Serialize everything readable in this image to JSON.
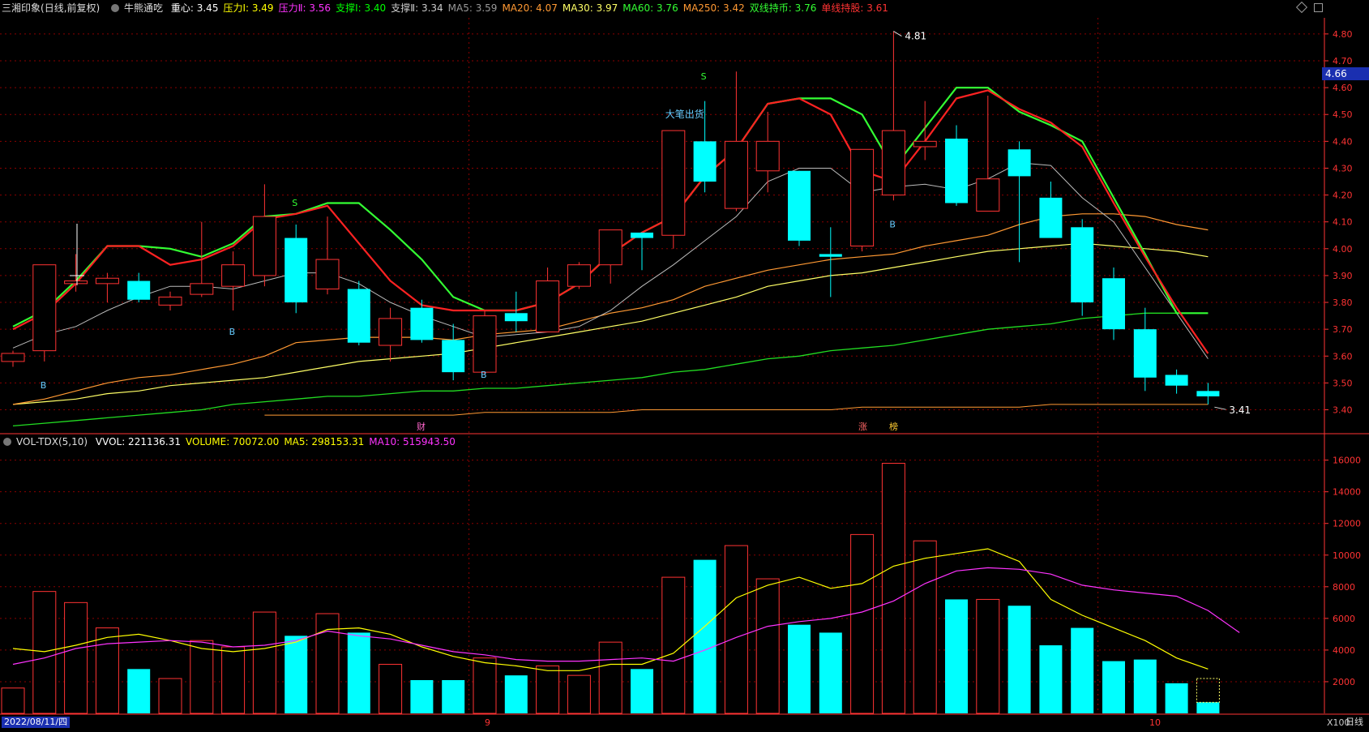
{
  "header": {
    "title": "三湘印象",
    "mode": "(日线,前复权)",
    "indicator": "牛熊通吃",
    "items": [
      {
        "label": "重心:",
        "value": "3.45",
        "color": "#ffffff"
      },
      {
        "label": "压力Ⅰ:",
        "value": "3.49",
        "color": "#ffff00"
      },
      {
        "label": "压力Ⅱ:",
        "value": "3.56",
        "color": "#ff33ff"
      },
      {
        "label": "支撑Ⅰ:",
        "value": "3.40",
        "color": "#00ff00"
      },
      {
        "label": "支撑Ⅱ:",
        "value": "3.34",
        "color": "#cccccc"
      },
      {
        "label": "MA5:",
        "value": "3.59",
        "color": "#999999"
      },
      {
        "label": "MA20:",
        "value": "4.07",
        "color": "#ff9933"
      },
      {
        "label": "MA30:",
        "value": "3.97",
        "color": "#ffff66"
      },
      {
        "label": "MA60:",
        "value": "3.76",
        "color": "#33ff33"
      },
      {
        "label": "MA250:",
        "value": "3.42",
        "color": "#ff9933"
      },
      {
        "label": "双线持币:",
        "value": "3.76",
        "color": "#33ff33"
      },
      {
        "label": "单线持股:",
        "value": "3.61",
        "color": "#ff3333"
      }
    ]
  },
  "vol_header": {
    "indicator": "VOL-TDX(5,10)",
    "items": [
      {
        "label": "VVOL:",
        "value": "221136.31",
        "color": "#ffffff"
      },
      {
        "label": "VOLUME:",
        "value": "70072.00",
        "color": "#ffff00"
      },
      {
        "label": "MA5:",
        "value": "298153.31",
        "color": "#ffff00"
      },
      {
        "label": "MA10:",
        "value": "515943.50",
        "color": "#ff33ff"
      }
    ]
  },
  "current_price": "4.66",
  "footer": {
    "date": "2022/08/11/四",
    "month_9": "9",
    "month_10": "10",
    "period": "日线",
    "scale": "X100"
  },
  "colors": {
    "up": "#ff3333",
    "down": "#00ffff",
    "grid": "#8b0000",
    "axis": "#ff3333"
  },
  "annotations": {
    "high_label": "4.81",
    "low_label": "3.41",
    "big_sell": "大笔出货",
    "events": [
      "财",
      "涨",
      "榜"
    ],
    "signals": [
      "S",
      "S",
      "B",
      "B",
      "B",
      "B"
    ]
  },
  "chart_data": {
    "type": "candlestick",
    "price_axis": {
      "ylim": [
        3.32,
        4.86
      ],
      "ticks": [
        "4.80",
        "4.70",
        "4.60",
        "4.50",
        "4.40",
        "4.30",
        "4.20",
        "4.10",
        "4.00",
        "3.90",
        "3.80",
        "3.70",
        "3.60",
        "3.50",
        "3.40"
      ]
    },
    "volume_axis": {
      "ylim": [
        0,
        16800
      ],
      "ticks": [
        "16000",
        "14000",
        "12000",
        "10000",
        "8000",
        "6000",
        "4000",
        "2000"
      ]
    },
    "candles": [
      {
        "o": 3.58,
        "h": 3.62,
        "l": 3.56,
        "c": 3.61
      },
      {
        "o": 3.62,
        "h": 3.94,
        "l": 3.58,
        "c": 3.94
      },
      {
        "o": 3.87,
        "h": 3.98,
        "l": 3.84,
        "c": 3.88
      },
      {
        "o": 3.87,
        "h": 3.91,
        "l": 3.8,
        "c": 3.89
      },
      {
        "o": 3.88,
        "h": 3.91,
        "l": 3.8,
        "c": 3.81
      },
      {
        "o": 3.79,
        "h": 3.84,
        "l": 3.77,
        "c": 3.82
      },
      {
        "o": 3.83,
        "h": 4.1,
        "l": 3.82,
        "c": 3.87
      },
      {
        "o": 3.86,
        "h": 3.99,
        "l": 3.77,
        "c": 3.94
      },
      {
        "o": 3.9,
        "h": 4.24,
        "l": 3.86,
        "c": 4.12
      },
      {
        "o": 4.04,
        "h": 4.09,
        "l": 3.76,
        "c": 3.8
      },
      {
        "o": 3.85,
        "h": 4.12,
        "l": 3.83,
        "c": 3.96
      },
      {
        "o": 3.85,
        "h": 3.88,
        "l": 3.64,
        "c": 3.65
      },
      {
        "o": 3.64,
        "h": 3.78,
        "l": 3.58,
        "c": 3.74
      },
      {
        "o": 3.78,
        "h": 3.81,
        "l": 3.65,
        "c": 3.66
      },
      {
        "o": 3.66,
        "h": 3.72,
        "l": 3.51,
        "c": 3.54
      },
      {
        "o": 3.54,
        "h": 3.77,
        "l": 3.53,
        "c": 3.75
      },
      {
        "o": 3.76,
        "h": 3.84,
        "l": 3.69,
        "c": 3.73
      },
      {
        "o": 3.69,
        "h": 3.93,
        "l": 3.69,
        "c": 3.88
      },
      {
        "o": 3.86,
        "h": 3.95,
        "l": 3.85,
        "c": 3.94
      },
      {
        "o": 3.94,
        "h": 4.07,
        "l": 3.87,
        "c": 4.07
      },
      {
        "o": 4.06,
        "h": 4.06,
        "l": 3.92,
        "c": 4.04
      },
      {
        "o": 4.05,
        "h": 4.44,
        "l": 4.0,
        "c": 4.44
      },
      {
        "o": 4.4,
        "h": 4.55,
        "l": 4.21,
        "c": 4.25
      },
      {
        "o": 4.15,
        "h": 4.66,
        "l": 4.14,
        "c": 4.4
      },
      {
        "o": 4.29,
        "h": 4.51,
        "l": 4.21,
        "c": 4.4
      },
      {
        "o": 4.29,
        "h": 4.29,
        "l": 4.01,
        "c": 4.03
      },
      {
        "o": 3.98,
        "h": 4.08,
        "l": 3.82,
        "c": 3.97
      },
      {
        "o": 4.01,
        "h": 4.37,
        "l": 3.99,
        "c": 4.37
      },
      {
        "o": 4.2,
        "h": 4.81,
        "l": 4.18,
        "c": 4.44
      },
      {
        "o": 4.38,
        "h": 4.55,
        "l": 4.33,
        "c": 4.4
      },
      {
        "o": 4.41,
        "h": 4.46,
        "l": 4.16,
        "c": 4.17
      },
      {
        "o": 4.14,
        "h": 4.57,
        "l": 4.14,
        "c": 4.26
      },
      {
        "o": 4.37,
        "h": 4.4,
        "l": 3.95,
        "c": 4.27
      },
      {
        "o": 4.19,
        "h": 4.25,
        "l": 4.04,
        "c": 4.04
      },
      {
        "o": 4.08,
        "h": 4.11,
        "l": 3.75,
        "c": 3.8
      },
      {
        "o": 3.89,
        "h": 3.93,
        "l": 3.66,
        "c": 3.7
      },
      {
        "o": 3.7,
        "h": 3.78,
        "l": 3.47,
        "c": 3.52
      },
      {
        "o": 3.53,
        "h": 3.55,
        "l": 3.46,
        "c": 3.49
      },
      {
        "o": 3.47,
        "h": 3.5,
        "l": 3.42,
        "c": 3.45
      }
    ],
    "volume": [
      1600,
      7700,
      7000,
      5400,
      2800,
      2200,
      4600,
      4200,
      6400,
      4900,
      6300,
      5100,
      3100,
      2100,
      2100,
      3500,
      2400,
      3000,
      2400,
      4500,
      2800,
      8600,
      9700,
      10600,
      8500,
      5600,
      5100,
      11300,
      15800,
      10900,
      7200,
      7200,
      6800,
      4300,
      5400,
      3300,
      3400,
      1900,
      700
    ],
    "lines": {
      "single_hold_red": [
        3.7,
        3.76,
        3.87,
        4.01,
        4.01,
        3.94,
        3.96,
        4.01,
        4.11,
        4.13,
        4.16,
        4.02,
        3.88,
        3.79,
        3.77,
        3.77,
        3.77,
        3.8,
        3.87,
        3.98,
        4.06,
        4.12,
        4.27,
        4.37,
        4.54,
        4.56,
        4.5,
        4.29,
        4.25,
        4.4,
        4.56,
        4.59,
        4.52,
        4.47,
        4.38,
        4.17,
        3.97,
        3.78,
        3.61
      ],
      "double_cash_green": [
        3.71,
        3.77,
        3.88,
        4.01,
        4.01,
        4.0,
        3.97,
        4.02,
        4.12,
        4.13,
        4.17,
        4.17,
        4.07,
        3.96,
        3.82,
        3.77,
        3.77,
        3.8,
        3.87,
        3.98,
        4.06,
        4.12,
        4.27,
        4.37,
        4.54,
        4.56,
        4.56,
        4.5,
        4.3,
        4.45,
        4.6,
        4.6,
        4.51,
        4.46,
        4.4,
        4.19,
        3.98,
        3.76,
        3.76
      ],
      "ma5": [
        3.63,
        3.68,
        3.71,
        3.77,
        3.82,
        3.86,
        3.86,
        3.85,
        3.88,
        3.91,
        3.91,
        3.87,
        3.8,
        3.75,
        3.71,
        3.67,
        3.68,
        3.69,
        3.71,
        3.77,
        3.86,
        3.94,
        4.03,
        4.12,
        4.25,
        4.3,
        4.3,
        4.21,
        4.23,
        4.24,
        4.22,
        4.26,
        4.32,
        4.31,
        4.19,
        4.1,
        3.93,
        3.76,
        3.59
      ],
      "ma20": [
        3.42,
        3.44,
        3.47,
        3.5,
        3.52,
        3.53,
        3.55,
        3.57,
        3.6,
        3.65,
        3.66,
        3.67,
        3.67,
        3.67,
        3.66,
        3.68,
        3.69,
        3.7,
        3.73,
        3.76,
        3.78,
        3.81,
        3.86,
        3.89,
        3.92,
        3.94,
        3.96,
        3.97,
        3.98,
        4.01,
        4.03,
        4.05,
        4.09,
        4.12,
        4.13,
        4.13,
        4.12,
        4.09,
        4.07
      ],
      "ma30": [
        3.42,
        3.43,
        3.44,
        3.46,
        3.47,
        3.49,
        3.5,
        3.51,
        3.52,
        3.54,
        3.56,
        3.58,
        3.59,
        3.6,
        3.61,
        3.63,
        3.65,
        3.67,
        3.69,
        3.71,
        3.73,
        3.76,
        3.79,
        3.82,
        3.86,
        3.88,
        3.9,
        3.91,
        3.93,
        3.95,
        3.97,
        3.99,
        4.0,
        4.01,
        4.02,
        4.01,
        4.0,
        3.99,
        3.97
      ],
      "ma60": [
        3.34,
        3.35,
        3.36,
        3.37,
        3.38,
        3.39,
        3.4,
        3.42,
        3.43,
        3.44,
        3.45,
        3.45,
        3.46,
        3.47,
        3.47,
        3.48,
        3.48,
        3.49,
        3.5,
        3.51,
        3.52,
        3.54,
        3.55,
        3.57,
        3.59,
        3.6,
        3.62,
        3.63,
        3.64,
        3.66,
        3.68,
        3.7,
        3.71,
        3.72,
        3.74,
        3.75,
        3.76,
        3.76,
        3.76
      ],
      "ma250": [
        null,
        null,
        null,
        null,
        null,
        null,
        null,
        null,
        3.38,
        3.38,
        3.38,
        3.38,
        3.38,
        3.38,
        3.38,
        3.39,
        3.39,
        3.39,
        3.39,
        3.39,
        3.4,
        3.4,
        3.4,
        3.4,
        3.4,
        3.4,
        3.4,
        3.41,
        3.41,
        3.41,
        3.41,
        3.41,
        3.41,
        3.42,
        3.42,
        3.42,
        3.42,
        3.42,
        3.42
      ],
      "vol_ma5": [
        4100,
        3900,
        4300,
        4800,
        5000,
        4600,
        4100,
        3900,
        4100,
        4500,
        5300,
        5400,
        5000,
        4200,
        3600,
        3200,
        3000,
        2700,
        2700,
        3100,
        3100,
        3800,
        5500,
        7300,
        8100,
        8600,
        7900,
        8200,
        9300,
        9800,
        10100,
        10400,
        9600,
        7200,
        6200,
        5400,
        4600,
        3500,
        2800
      ],
      "vol_ma10": [
        3100,
        3500,
        4100,
        4400,
        4500,
        4600,
        4500,
        4200,
        4300,
        4600,
        5200,
        4900,
        4700,
        4300,
        3900,
        3700,
        3400,
        3300,
        3300,
        3400,
        3500,
        3300,
        4000,
        4800,
        5500,
        5800,
        6000,
        6400,
        7100,
        8200,
        9000,
        9200,
        9100,
        8800,
        8100,
        7800,
        7600,
        7400,
        6500,
        5100
      ]
    }
  }
}
